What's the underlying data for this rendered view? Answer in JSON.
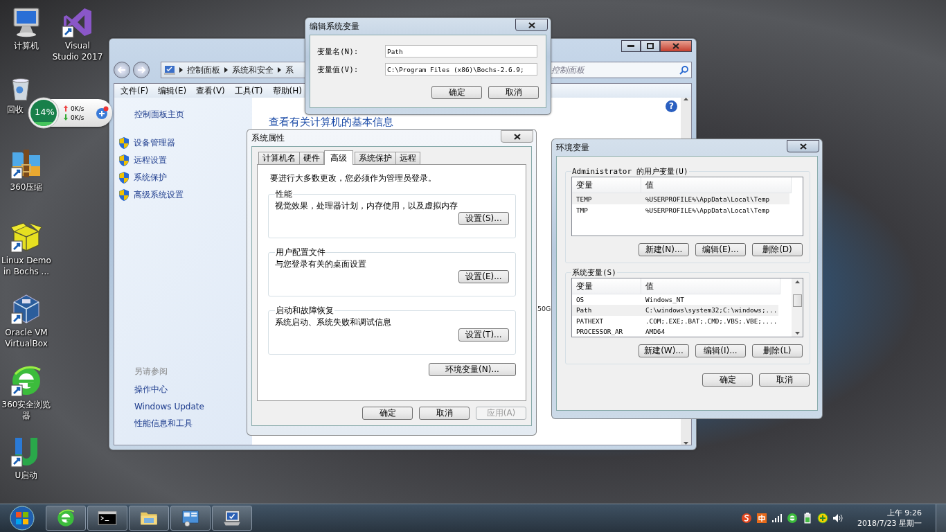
{
  "desktop_icons": [
    {
      "label": "计算机",
      "kind": "computer",
      "shortcut": false
    },
    {
      "label": "Visual Studio 2017",
      "kind": "vs",
      "shortcut": true
    },
    {
      "label": "回收",
      "kind": "recycle",
      "shortcut": false
    },
    {
      "label": "360压缩",
      "kind": "archive",
      "shortcut": true
    },
    {
      "label": "Linux Demo in Bochs ...",
      "kind": "box",
      "shortcut": true
    },
    {
      "label": "Oracle VM VirtualBox",
      "kind": "cube",
      "shortcut": true
    },
    {
      "label": "360安全浏览器",
      "kind": "ebrowser",
      "shortcut": true
    },
    {
      "label": "U启动",
      "kind": "ulogo",
      "shortcut": true
    }
  ],
  "net_widget": {
    "percent": "14%",
    "upload": "0K/s",
    "download": "0K/s"
  },
  "system_window": {
    "breadcrumb": [
      "控制面板",
      "系统和安全",
      "系"
    ],
    "search_placeholder": "控制面板",
    "menu": [
      "文件(F)",
      "编辑(E)",
      "查看(V)",
      "工具(T)",
      "帮助(H)"
    ],
    "home_link": "控制面板主页",
    "tasks": [
      "设备管理器",
      "远程设置",
      "系统保护",
      "高级系统设置"
    ],
    "see_also_title": "另请参阅",
    "see_also": [
      "操作中心",
      "Windows Update",
      "性能信息和工具"
    ],
    "heading": "查看有关计算机的基本信息",
    "help_button": "?",
    "fragment": "50G"
  },
  "edit_dialog": {
    "title": "编辑系统变量",
    "fields": [
      {
        "label": "变量名(N):",
        "value": "Path"
      },
      {
        "label": "变量值(V):",
        "value": "C:\\Program Files (x86)\\Bochs-2.6.9;"
      }
    ],
    "buttons": [
      "确定",
      "取消"
    ]
  },
  "system_properties": {
    "title": "系统属性",
    "tabs": [
      {
        "label": "计算机名",
        "selected": false
      },
      {
        "label": "硬件",
        "selected": false
      },
      {
        "label": "高级",
        "selected": true
      },
      {
        "label": "系统保护",
        "selected": false
      },
      {
        "label": "远程",
        "selected": false
      }
    ],
    "notice": "要进行大多数更改，您必须作为管理员登录。",
    "groups": [
      {
        "title": "性能",
        "description": "视觉效果，处理器计划，内存使用，以及虚拟内存",
        "button": "设置(S)..."
      },
      {
        "title": "用户配置文件",
        "description": "与您登录有关的桌面设置",
        "button": "设置(E)..."
      },
      {
        "title": "启动和故障恢复",
        "description": "系统启动、系统失败和调试信息",
        "button": "设置(T)..."
      }
    ],
    "env_button": "环境变量(N)...",
    "buttons": [
      {
        "label": "确定",
        "disabled": false
      },
      {
        "label": "取消",
        "disabled": false
      },
      {
        "label": "应用(A)",
        "disabled": true
      }
    ]
  },
  "env_dialog": {
    "title": "环境变量",
    "sections": [
      {
        "title": "Administrator 的用户变量(U)",
        "columns": [
          "变量",
          "值"
        ],
        "scrollbar": false,
        "rows": [
          {
            "name": "TEMP",
            "value": "%USERPROFILE%\\AppData\\Local\\Temp",
            "selected": true
          },
          {
            "name": "TMP",
            "value": "%USERPROFILE%\\AppData\\Local\\Temp",
            "selected": false
          }
        ],
        "buttons": [
          "新建(N)...",
          "编辑(E)...",
          "删除(D)"
        ]
      },
      {
        "title": "系统变量(S)",
        "columns": [
          "变量",
          "值"
        ],
        "scrollbar": true,
        "rows": [
          {
            "name": "OS",
            "value": "Windows_NT",
            "selected": false
          },
          {
            "name": "Path",
            "value": "C:\\windows\\system32;C:\\windows;...",
            "selected": true
          },
          {
            "name": "PATHEXT",
            "value": ".COM;.EXE;.BAT;.CMD;.VBS;.VBE;....",
            "selected": false
          },
          {
            "name": "PROCESSOR_AR",
            "value": "AMD64",
            "selected": false
          }
        ],
        "buttons": [
          "新建(W)...",
          "编辑(I)...",
          "删除(L)"
        ]
      }
    ],
    "buttons": [
      "确定",
      "取消"
    ]
  },
  "taskbar": {
    "apps": [
      {
        "kind": "ebrowser"
      },
      {
        "kind": "cmd"
      },
      {
        "kind": "folder"
      },
      {
        "kind": "cpanel"
      },
      {
        "kind": "sysmon"
      }
    ],
    "time": "上午 9:26",
    "date": "2018/7/23 星期一"
  }
}
